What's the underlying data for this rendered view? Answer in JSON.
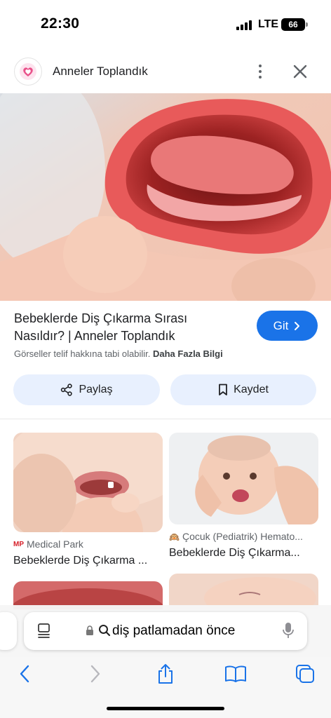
{
  "status_bar": {
    "time": "22:30",
    "network": "LTE",
    "battery": "66"
  },
  "source": {
    "name": "Anneler Toplandık",
    "logo_icon": "heart-logo-icon"
  },
  "result": {
    "title": "Bebeklerde Diş Çıkarma Sırası Nasıldır? | Anneler Toplandık",
    "go_label": "Git",
    "copyright_text": "Görseller telif hakkına tabi olabilir.",
    "more_info_label": "Daha Fazla Bilgi",
    "share_label": "Paylaş",
    "save_label": "Kaydet"
  },
  "related": [
    {
      "source": "Medical Park",
      "source_badge": "MP",
      "title": "Bebeklerde Diş Çıkarma ..."
    },
    {
      "source": "Çocuk (Pediatrik) Hemato...",
      "source_badge": "🙉",
      "title": "Bebeklerde Diş Çıkarma..."
    },
    {
      "source": "",
      "title": ""
    },
    {
      "source": "",
      "title": ""
    }
  ],
  "browser": {
    "address_text": "diş patlamadan önce"
  },
  "colors": {
    "accent": "#1a73e8",
    "chip_bg": "#e8f0fe",
    "medical_park_red": "#d6202a"
  }
}
